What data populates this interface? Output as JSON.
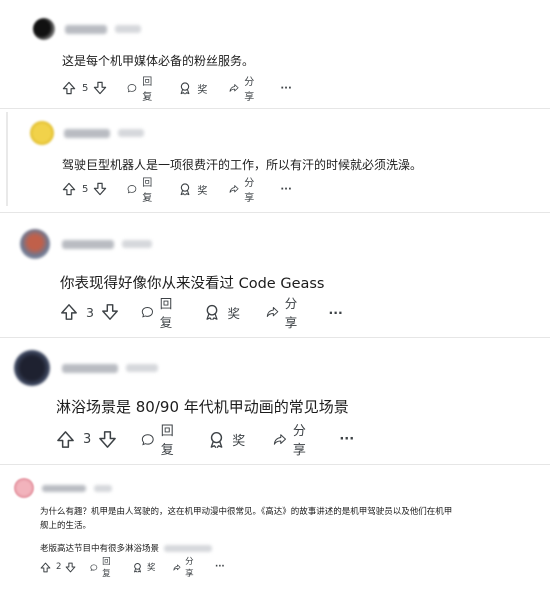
{
  "comments": [
    {
      "text": "这是每个机甲媒体必备的粉丝服务。",
      "votes": "5",
      "actions": {
        "reply": "回复",
        "award": "奖",
        "share": "分享",
        "more": "···"
      }
    },
    {
      "text": "驾驶巨型机器人是一项很费汗的工作，所以有汗的时候就必须洗澡。",
      "votes": "5",
      "actions": {
        "reply": "回复",
        "award": "奖",
        "share": "分享",
        "more": "···"
      }
    },
    {
      "text": "你表现得好像你从来没看过 Code Geass",
      "votes": "3",
      "actions": {
        "reply": "回复",
        "award": "奖",
        "share": "分享",
        "more": "···"
      }
    },
    {
      "text": "淋浴场景是 80/90 年代机甲动画的常见场景",
      "votes": "3",
      "actions": {
        "reply": "回复",
        "award": "奖",
        "share": "分享",
        "more": "···"
      }
    },
    {
      "text_line1": "为什么有趣？机甲是由人驾驶的，这在机甲动漫中很常见。《高达》的故事讲述的是机甲驾驶员以及他们在机甲",
      "text_line2": "舰上的生活。",
      "text_line3": "老版高达节目中有很多淋浴场景",
      "votes": "2",
      "actions": {
        "reply": "回复",
        "award": "奖",
        "share": "分享",
        "more": "···"
      }
    }
  ],
  "colors": {
    "text": "#1c1c1c",
    "icon": "#3d4246",
    "divider": "#e6e6e6",
    "avatar1": "#2b2b2b",
    "avatar2": "#e4c33a",
    "avatar3": "#b55a4a",
    "avatar4": "#23262e",
    "avatar5": "#e8a3ad"
  },
  "icons": [
    "upvote-icon",
    "downvote-icon",
    "reply-icon",
    "award-icon",
    "share-icon",
    "more-icon"
  ]
}
